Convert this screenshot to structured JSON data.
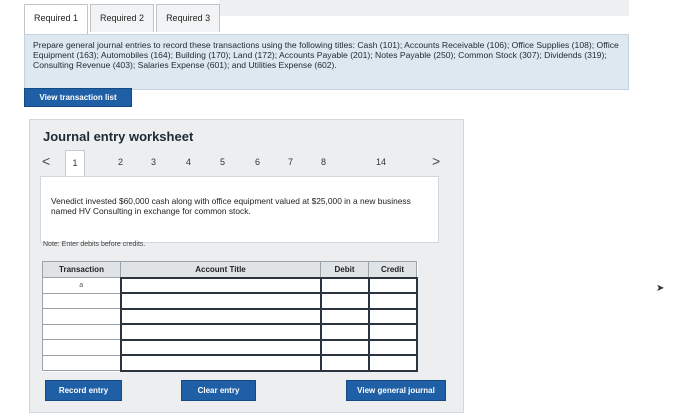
{
  "tabs": [
    {
      "label": "Required 1"
    },
    {
      "label": "Required 2"
    },
    {
      "label": "Required 3"
    }
  ],
  "instructions": "Prepare general journal entries to record these transactions using the following titles: Cash (101); Accounts Receivable (106); Office Supplies (108); Office Equipment (163); Automobiles (164); Building (170); Land (172); Accounts Payable (201); Notes Payable (250); Common Stock (307); Dividends (319); Consulting Revenue (403); Salaries Expense (601); and Utilities Expense (602).",
  "buttons": {
    "view_transaction_list": "View transaction list",
    "record_entry": "Record entry",
    "clear_entry": "Clear entry",
    "view_general_journal": "View general journal"
  },
  "worksheet": {
    "title": "Journal entry worksheet",
    "pager": {
      "prev_icon": "<",
      "next_icon": ">",
      "pages": [
        "1",
        "2",
        "3",
        "4",
        "5",
        "6",
        "7",
        "8",
        "14"
      ]
    },
    "description": "Venedict invested $60,000 cash along with office equipment valued at $25,000 in a new business named HV Consulting in exchange for common stock.",
    "note": "Note: Enter debits before credits.",
    "table": {
      "headers": {
        "transaction": "Transaction",
        "account_title": "Account Title",
        "debit": "Debit",
        "credit": "Credit"
      },
      "transaction_label": "a"
    }
  }
}
